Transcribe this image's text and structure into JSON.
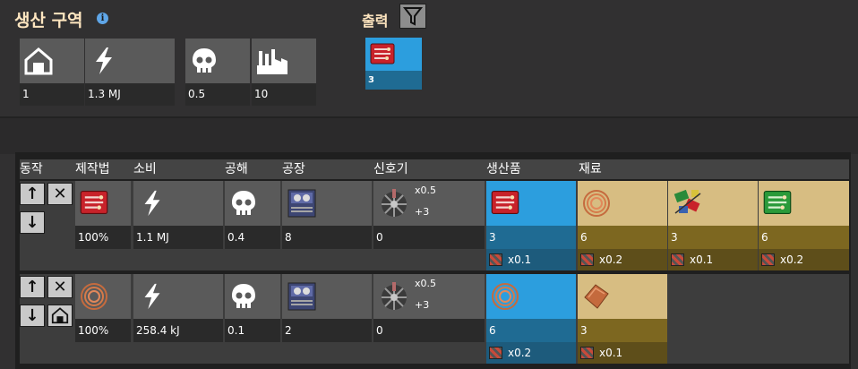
{
  "header": {
    "title": "생산 구역",
    "info_icon": "info-icon"
  },
  "stats": [
    {
      "icon": "building-icon",
      "value": "1"
    },
    {
      "icon": "lightning-icon",
      "value": "1.3 MJ"
    },
    {
      "icon": "skull-icon",
      "value": "0.5"
    },
    {
      "icon": "factory-icon",
      "value": "10"
    }
  ],
  "output": {
    "label": "출력",
    "filter_icon": "filter-icon",
    "item_icon": "electronic-circuit-icon",
    "count": "3"
  },
  "table": {
    "headers": [
      "동작",
      "제작법",
      "소비",
      "공해",
      "공장",
      "신호기",
      "생산품",
      "재료"
    ],
    "rows": [
      {
        "recipe_icon": "electronic-circuit-icon",
        "recipe_pct": "100%",
        "consumption": "1.1 MJ",
        "pollution": "0.4",
        "factory": "8",
        "beacon_count": "0",
        "beacon_mult": "x0.5",
        "beacon_plus": "+3",
        "products": [
          {
            "icon": "electronic-circuit-icon",
            "count": "3",
            "rate": "x0.1"
          }
        ],
        "ingredients": [
          {
            "icon": "copper-cable-icon",
            "count": "6",
            "rate": "x0.2"
          },
          {
            "icon": "circuit-parts-icon",
            "count": "3",
            "rate": "x0.1"
          },
          {
            "icon": "green-circuit-icon",
            "count": "6",
            "rate": "x0.2"
          }
        ]
      },
      {
        "recipe_icon": "copper-cable-icon",
        "recipe_pct": "100%",
        "consumption": "258.4 kJ",
        "pollution": "0.1",
        "factory": "2",
        "beacon_count": "0",
        "beacon_mult": "x0.5",
        "beacon_plus": "+3",
        "products": [
          {
            "icon": "copper-cable-icon",
            "count": "6",
            "rate": "x0.2"
          }
        ],
        "ingredients": [
          {
            "icon": "copper-plate-icon",
            "count": "3",
            "rate": "x0.1"
          }
        ]
      }
    ]
  }
}
